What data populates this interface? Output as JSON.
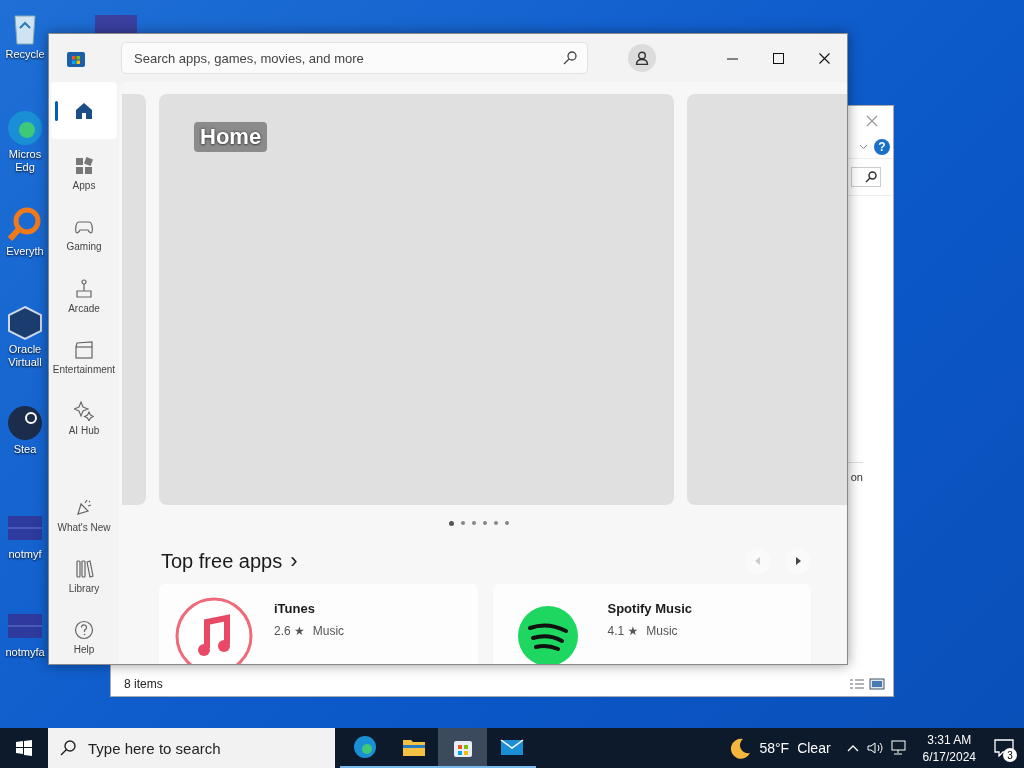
{
  "desktop_icons": [
    {
      "kind": "recycle",
      "lines": [
        "Recycle"
      ]
    },
    {
      "kind": "edge",
      "lines": [
        "Micros",
        "Edg"
      ]
    },
    {
      "kind": "search",
      "lines": [
        "Everyth"
      ]
    },
    {
      "kind": "box",
      "lines": [
        "Oracle",
        "Virtuall"
      ]
    },
    {
      "kind": "steam",
      "lines": [
        "Stea"
      ]
    },
    {
      "kind": "file",
      "lines": [
        "notmyf"
      ]
    },
    {
      "kind": "file",
      "lines": [
        "notmyfa"
      ]
    }
  ],
  "explorer_window": {
    "help_glyph": "?",
    "side_text": "on",
    "status": "8 items"
  },
  "store_window": {
    "search": {
      "placeholder": "Search apps, games, movies, and more"
    },
    "nav": [
      {
        "kind": "home",
        "selected": true
      },
      {
        "kind": "apps",
        "label": "Apps",
        "selected": false
      },
      {
        "kind": "gaming",
        "label": "Gaming",
        "selected": false
      },
      {
        "kind": "arcade",
        "label": "Arcade",
        "selected": false
      },
      {
        "kind": "entertainment",
        "label": "Entertainment",
        "selected": false
      },
      {
        "kind": "ai",
        "label": "AI Hub",
        "selected": false
      },
      {
        "kind": "new",
        "label": "What's New",
        "selected": false
      },
      {
        "kind": "library",
        "label": "Library",
        "selected": false
      },
      {
        "kind": "help",
        "label": "Help",
        "selected": false
      }
    ],
    "hero": {
      "title": "Home"
    },
    "carousel_dots": [
      {
        "selected": true
      },
      {
        "selected": false
      },
      {
        "selected": false
      },
      {
        "selected": false
      },
      {
        "selected": false
      },
      {
        "selected": false
      }
    ],
    "section": {
      "title": "Top free apps",
      "chevron": "›"
    },
    "apps": [
      {
        "kind": "itunes",
        "name": "iTunes",
        "rating": "2.6 ★",
        "category": "Music"
      },
      {
        "kind": "spotify",
        "name": "Spotify Music",
        "rating": "4.1 ★",
        "category": "Music"
      }
    ]
  },
  "taskbar": {
    "search_placeholder": "Type here to search",
    "apps": [
      {
        "kind": "edge",
        "selected": false
      },
      {
        "kind": "folder",
        "selected": false
      },
      {
        "kind": "store",
        "selected": true
      },
      {
        "kind": "mail",
        "selected": false
      }
    ],
    "weather": {
      "temperature": "58°F",
      "condition": "Clear"
    },
    "time": "3:31 AM",
    "date": "6/17/2024",
    "notification_count": "3"
  }
}
